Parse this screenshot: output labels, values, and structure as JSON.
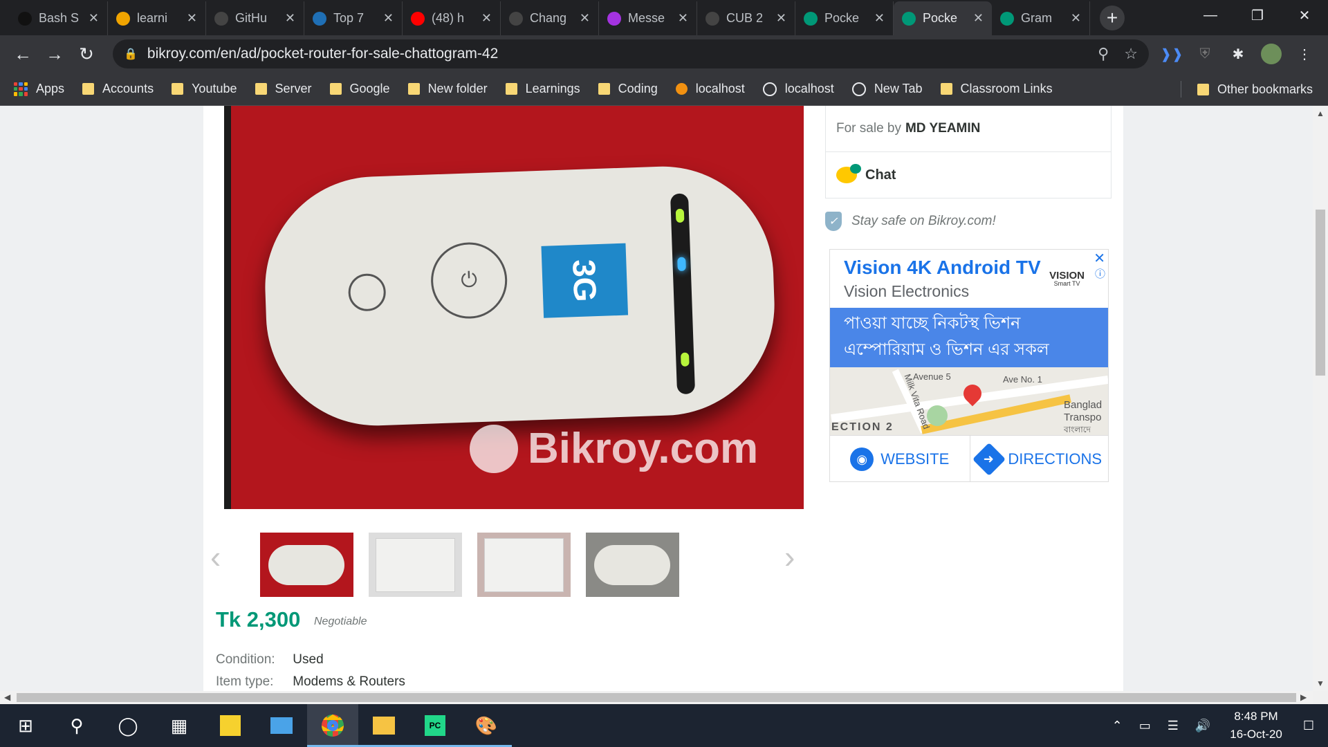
{
  "tabs": [
    {
      "title": "Bash S",
      "icon": "terminal-icon",
      "color": "#111111"
    },
    {
      "title": "learni",
      "icon": "coursera-icon",
      "color": "#f0a400"
    },
    {
      "title": "GitHu",
      "icon": "github-icon",
      "color": "#444444"
    },
    {
      "title": "Top 7",
      "icon": "codeforces-icon",
      "color": "#1f6fb5"
    },
    {
      "title": "(48) h",
      "icon": "youtube-icon",
      "color": "#ff0000"
    },
    {
      "title": "Chang",
      "icon": "github-icon",
      "color": "#444444"
    },
    {
      "title": "Messe",
      "icon": "messenger-icon",
      "color": "#a433e0"
    },
    {
      "title": "CUB 2",
      "icon": "github-icon",
      "color": "#444444"
    },
    {
      "title": "Pocke",
      "icon": "bikroy-icon",
      "color": "#009877"
    },
    {
      "title": "Pocke",
      "icon": "bikroy-icon",
      "color": "#009877",
      "active": true
    },
    {
      "title": "Gram",
      "icon": "bikroy-icon",
      "color": "#009877"
    }
  ],
  "address": {
    "url": "bikroy.com/en/ad/pocket-router-for-sale-chattogram-42"
  },
  "bookmarks": {
    "items": [
      "Apps",
      "Accounts",
      "Youtube",
      "Server",
      "Google",
      "New folder",
      "Learnings",
      "Coding",
      "localhost",
      "localhost",
      "New Tab",
      "Classroom Links"
    ],
    "other": "Other bookmarks"
  },
  "listing": {
    "watermark": "Bikroy.com",
    "device_badge": "3G",
    "seller_prefix": "For sale by",
    "seller_name": "MD YEAMIN",
    "chat_label": "Chat",
    "safety_text": "Stay safe on Bikroy.com!",
    "price": "Tk 2,300",
    "negotiable": "Negotiable",
    "attributes": [
      {
        "key": "Condition:",
        "value": "Used"
      },
      {
        "key": "Item type:",
        "value": "Modems & Routers"
      }
    ],
    "thumbnail_count": 4,
    "selected_thumbnail": 1
  },
  "ad": {
    "title": "Vision 4K Android TV",
    "subtitle": "Vision Electronics",
    "brand": "VISION",
    "brand_sub": "Smart TV",
    "banner": "পাওয়া যাচ্ছে নিকটস্থ ভিশন এম্পোরিয়াম ও ভিশন এর সকল শোরুমে",
    "map_labels": [
      "Avenue 5",
      "Ave No. 1",
      "Milk Vita Road",
      "ECTION 2",
      "Banglad",
      "Transpo",
      "বাংলাদে"
    ],
    "website": "WEBSITE",
    "directions": "DIRECTIONS"
  },
  "taskbar": {
    "time": "8:48 PM",
    "date": "16-Oct-20"
  }
}
